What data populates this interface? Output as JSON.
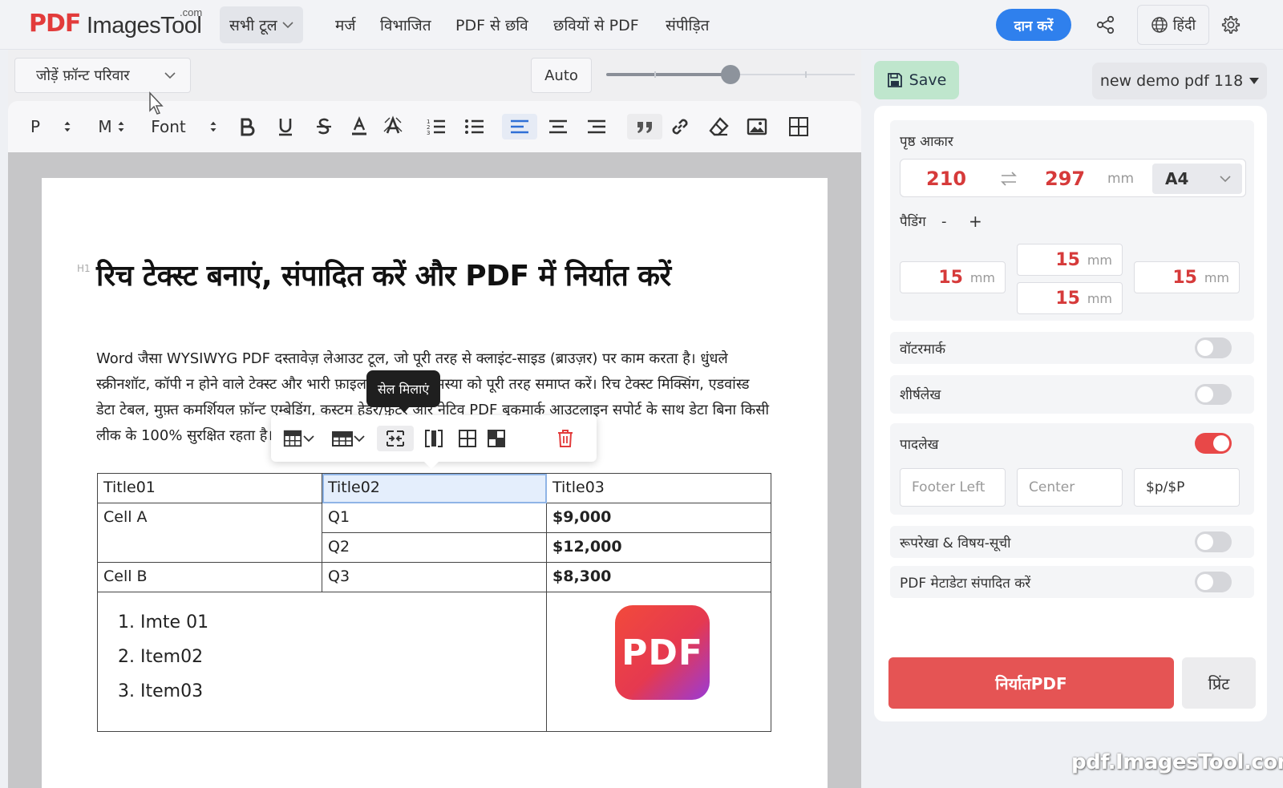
{
  "brand": {
    "pdf": "PDF",
    "rest": "ImagesTool",
    "com": ".com"
  },
  "nav": {
    "all_tools": "सभी टूल",
    "items": [
      "मर्ज",
      "विभाजित",
      "PDF से छवि",
      "छवियों से PDF",
      "संपीड़ित"
    ],
    "donate": "दान करें",
    "language": "हिंदी"
  },
  "editor": {
    "font_family_select": "जोड़ें फ़ॉन्ट परिवार",
    "zoom": "Auto",
    "zoom_level": 0.5,
    "toolbar": {
      "paragraph": "P",
      "size": "M",
      "font": "Font"
    },
    "doc_title_marker": "H1",
    "doc_title": "रिच टेक्स्ट बनाएं, संपादित करें और PDF में निर्यात करें",
    "doc_paragraph": "Word जैसा WYSIWYG PDF दस्तावेज़ लेआउट टूल, जो पूरी तरह से क्लाइंट-साइड (ब्राउज़र) पर काम करता है। धुंधले स्क्रीनशॉट, कॉपी न होने वाले टेक्स्ट और भारी फ़ाइल साइज़ की समस्या को पूरी तरह समाप्त करें। रिच टेक्स्ट मिक्सिंग, एडवांस्ड डेटा टेबल, मुफ़्त कमर्शियल फ़ॉन्ट एम्बेडिंग, कस्टम हेडर/फ़ुटर और नेटिव PDF बुकमार्क आउटलाइन सपोर्ट के साथ डेटा बिना किसी लीक के 100% सुरक्षित रहता है।",
    "tooltip": "सेल मिलाएं",
    "table": {
      "headers": [
        "Title01",
        "Title02",
        "Title03"
      ],
      "row1": [
        "Cell A",
        "Q1",
        "$9,000"
      ],
      "row2": [
        "Q2",
        "$12,000"
      ],
      "row3": [
        "Cell B",
        "Q3",
        "$8,300"
      ],
      "list": [
        "Imte 01",
        "Item02",
        "Item03"
      ],
      "logo_text": "PDF"
    }
  },
  "panel": {
    "save": "Save",
    "document": "new demo pdf 118",
    "page_size_label": "पृष्ठ आकार",
    "width": "210",
    "height": "297",
    "unit": "mm",
    "paper": "A4",
    "padding_label": "पैडिंग",
    "padding_minus": "-",
    "padding_plus": "+",
    "padding": {
      "top": "15",
      "left": "15",
      "bottom": "15",
      "right": "15"
    },
    "watermark": {
      "label": "वॉटरमार्क",
      "on": false
    },
    "header": {
      "label": "शीर्षलेख",
      "on": false
    },
    "footer": {
      "label": "पादलेख",
      "on": true,
      "left_placeholder": "Footer Left",
      "center_placeholder": "Center",
      "right_value": "$p/$P"
    },
    "outline": {
      "label": "रूपरेखा & विषय-सूची",
      "on": false
    },
    "metadata": {
      "label": "PDF मेटाडेटा संपादित करें",
      "on": false
    },
    "export": "निर्यातPDF",
    "print": "प्रिंट"
  },
  "watermark_site": "pdf.ImagesTool.com",
  "colors": {
    "accent_red": "#e55454",
    "donate_blue": "#2f80ed",
    "save_green": "#bfe6cd"
  }
}
